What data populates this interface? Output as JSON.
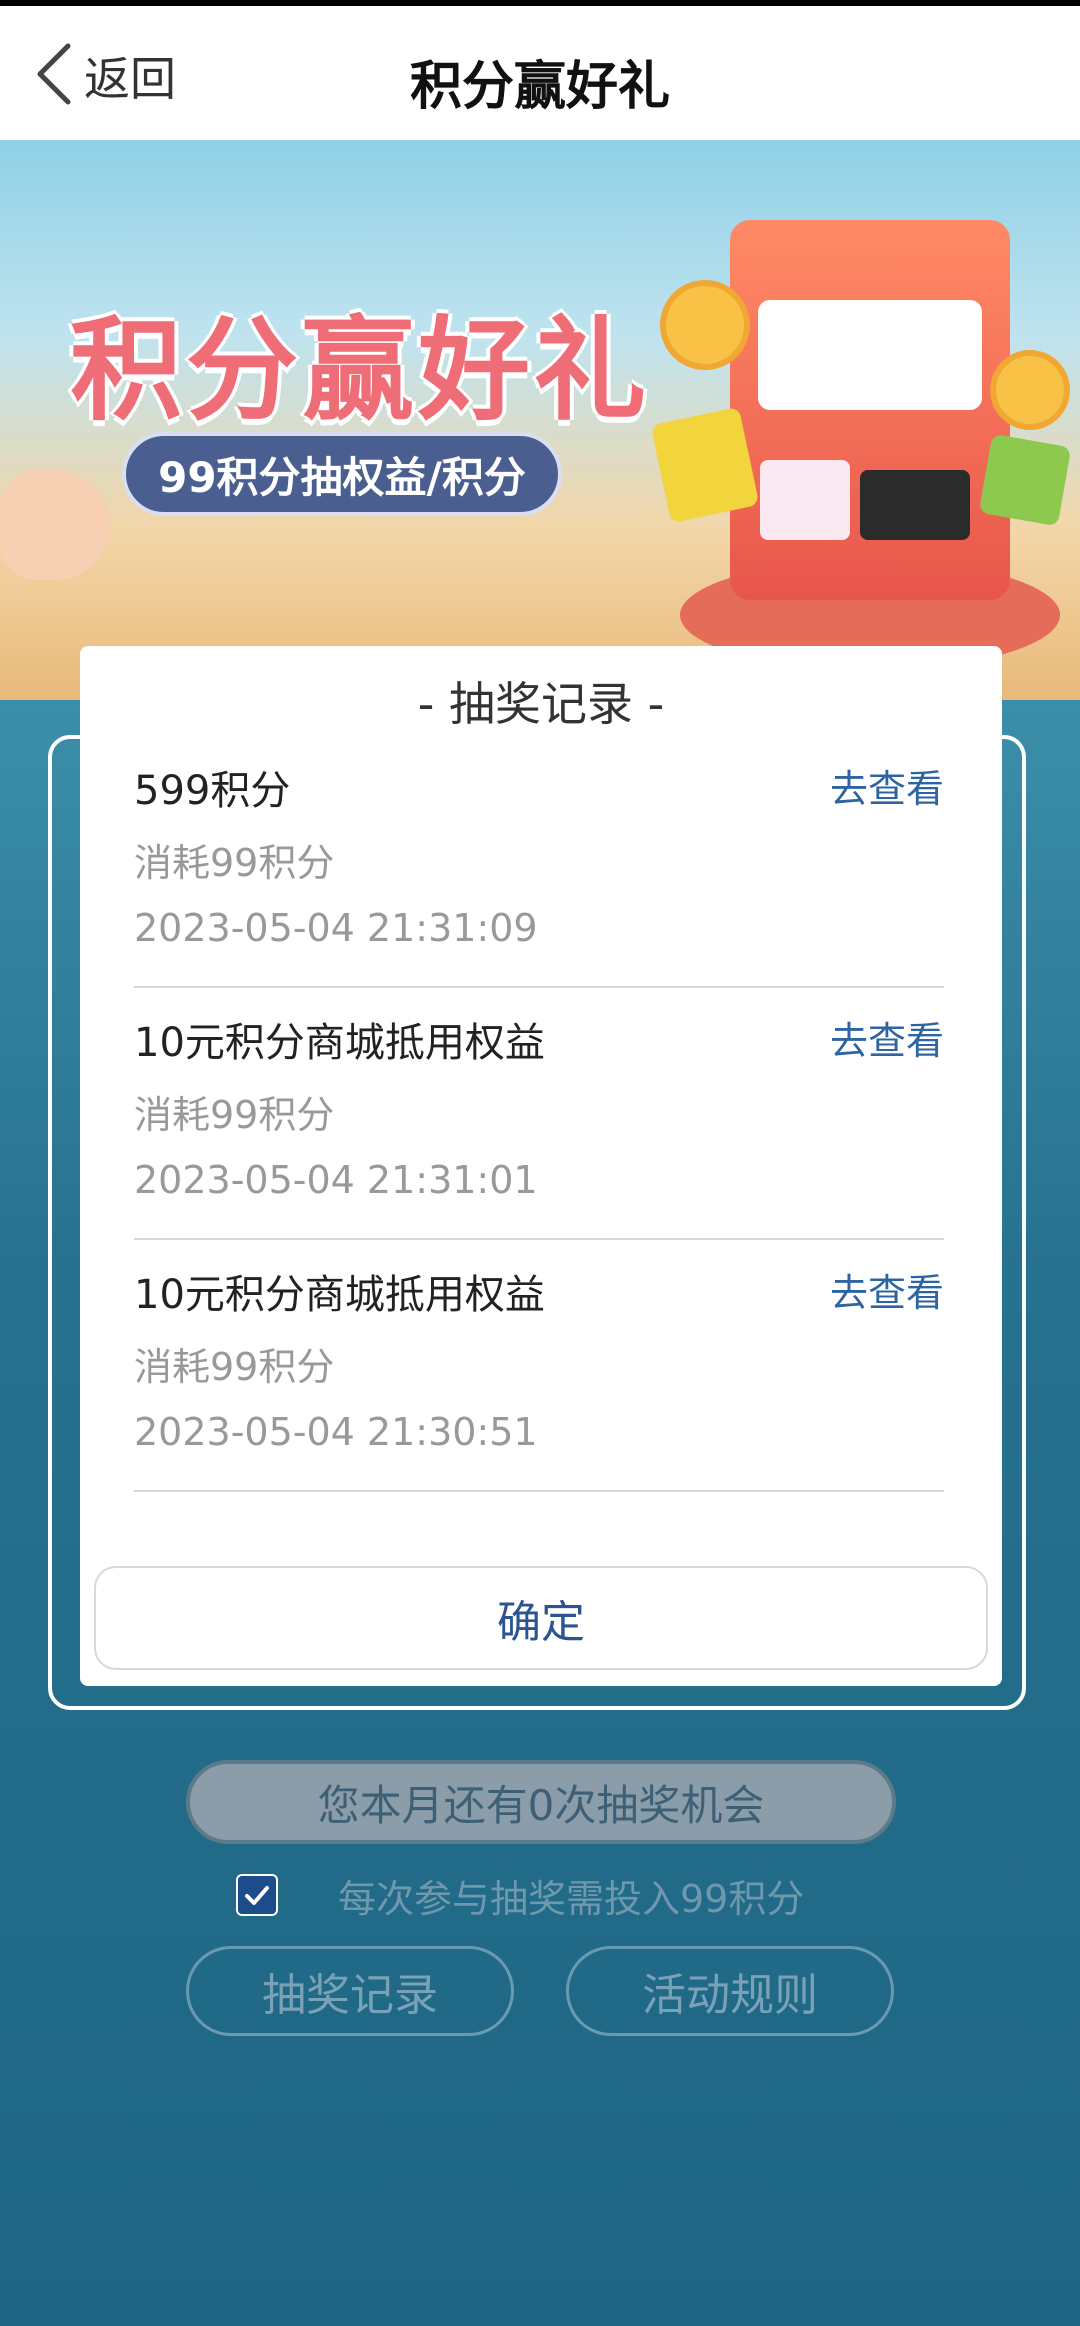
{
  "nav": {
    "back_label": "返回",
    "title": "积分赢好礼"
  },
  "banner": {
    "headline": "积分赢好礼",
    "subtitle": "99积分抽权益/积分"
  },
  "modal": {
    "title": "- 抽奖记录 -",
    "records": [
      {
        "name": "599积分",
        "link": "去查看",
        "cost": "消耗99积分",
        "time": "2023-05-04 21:31:09"
      },
      {
        "name": "10元积分商城抵用权益",
        "link": "去查看",
        "cost": "消耗99积分",
        "time": "2023-05-04 21:31:01"
      },
      {
        "name": "10元积分商城抵用权益",
        "link": "去查看",
        "cost": "消耗99积分",
        "time": "2023-05-04 21:30:51"
      }
    ],
    "confirm_label": "确定"
  },
  "page": {
    "chances_text": "您本月还有0次抽奖机会",
    "agree_text": "每次参与抽奖需投入99积分",
    "agree_checked": true,
    "records_button": "抽奖记录",
    "rules_button": "活动规则"
  },
  "colors": {
    "link": "#2f64a2",
    "background": "#1e6c8b",
    "checkbox": "#1c4c8c"
  }
}
